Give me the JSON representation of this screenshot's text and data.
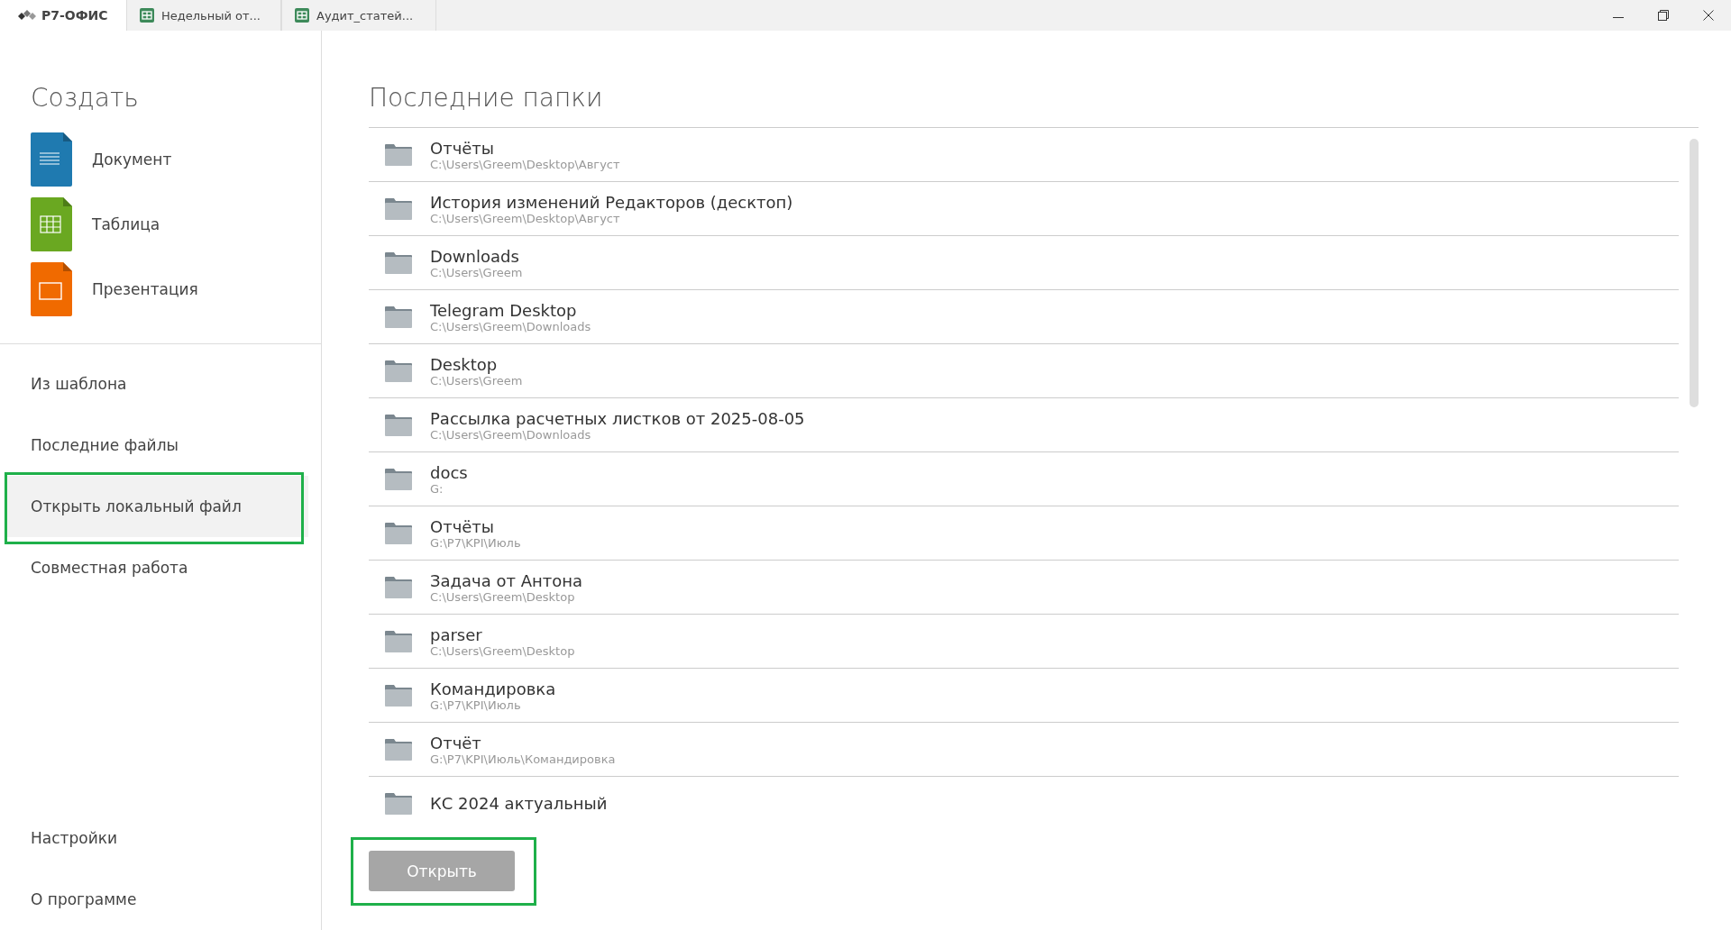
{
  "title_bar": {
    "logo": "Р7-ОФИС",
    "tabs": [
      {
        "label": "Недельный от...",
        "kind": "spreadsheet",
        "selected": false
      },
      {
        "label": "Аудит_статей...",
        "kind": "spreadsheet",
        "selected": false
      }
    ]
  },
  "sidebar": {
    "create_heading": "Создать",
    "create_items": [
      {
        "label": "Документ",
        "kind": "document"
      },
      {
        "label": "Таблица",
        "kind": "spreadsheet"
      },
      {
        "label": "Презентация",
        "kind": "presentation"
      }
    ],
    "nav_items": [
      {
        "label": "Из шаблона",
        "selected": false,
        "highlighted": false
      },
      {
        "label": "Последние файлы",
        "selected": false,
        "highlighted": false
      },
      {
        "label": "Открыть локальный файл",
        "selected": true,
        "highlighted": true
      },
      {
        "label": "Совместная работа",
        "selected": false,
        "highlighted": false
      }
    ],
    "bottom_items": [
      {
        "label": "Настройки"
      },
      {
        "label": "О программе"
      }
    ]
  },
  "main": {
    "heading": "Последние папки",
    "folders": [
      {
        "name": "Отчёты",
        "path": "C:\\Users\\Greem\\Desktop\\Август"
      },
      {
        "name": "История изменений Редакторов (десктоп)",
        "path": "C:\\Users\\Greem\\Desktop\\Август"
      },
      {
        "name": "Downloads",
        "path": "C:\\Users\\Greem"
      },
      {
        "name": "Telegram Desktop",
        "path": "C:\\Users\\Greem\\Downloads"
      },
      {
        "name": "Desktop",
        "path": "C:\\Users\\Greem"
      },
      {
        "name": "Рассылка расчетных листков от 2025-08-05",
        "path": "C:\\Users\\Greem\\Downloads"
      },
      {
        "name": "docs",
        "path": "G:"
      },
      {
        "name": "Отчёты",
        "path": "G:\\P7\\KPI\\Июль"
      },
      {
        "name": "Задача от Антона",
        "path": "C:\\Users\\Greem\\Desktop"
      },
      {
        "name": "parser",
        "path": "C:\\Users\\Greem\\Desktop"
      },
      {
        "name": "Командировка",
        "path": "G:\\P7\\KPI\\Июль"
      },
      {
        "name": "Отчёт",
        "path": "G:\\P7\\KPI\\Июль\\Командировка"
      },
      {
        "name": "КС 2024 актуальный"
      }
    ],
    "open_button": {
      "label": "Открыть",
      "highlighted": true
    }
  }
}
